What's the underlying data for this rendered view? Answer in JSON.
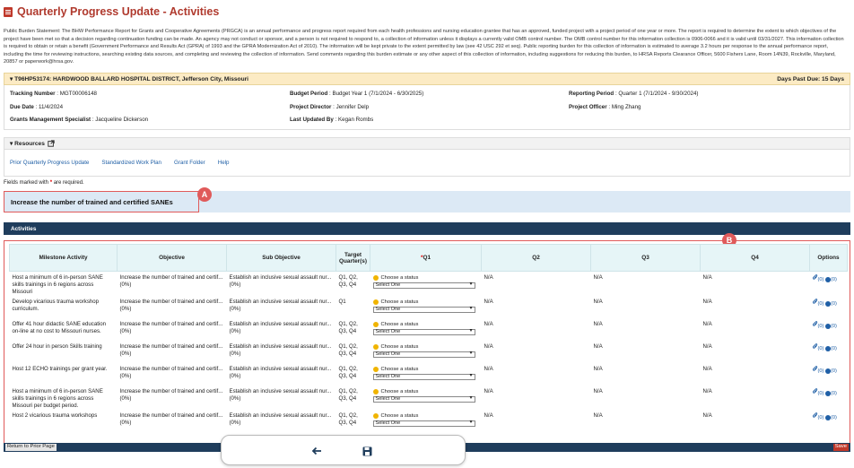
{
  "page": {
    "title": "Quarterly Progress Update - Activities",
    "burden_statement": "Public Burden Statement: The BHW Performance Report for Grants and Cooperative Agreements (PRGCA) is an annual performance and progress report required from each health professions and nursing education grantee that has an approved, funded project with a project period of one year or more. The report is required to determine the extent to which objectives of the project have been met so that a decision regarding continuation funding can be made. An agency may not conduct or sponsor, and a person is not required to respond to, a collection of information unless it displays a currently valid OMB control number. The OMB control number for this information collection is 0906-0066 and it is valid until 03/31/2027. This information collection is required to obtain or retain a benefit (Government Performance and Results Act (GPRA) of 1993 and the GPRA Modernization Act of 2010). The information will be kept private to the extent permitted by law (see 42 USC 292 et seq). Public reporting burden for this collection of information is estimated to average 3.2 hours per response to the annual performance report, including the time for reviewing instructions, searching existing data sources, and completing and reviewing the collection of information. Send comments regarding this burden estimate or any other aspect of this collection of information, including suggestions for reducing this burden, to HRSA Reports Clearance Officer, 5600 Fishers Lane, Room 14N39, Rockville, Maryland, 20857 or paperwork@hrsa.gov."
  },
  "grantee": {
    "header": "▾ T96HP53174: HARDWOOD BALLARD HOSPITAL DISTRICT, Jefferson City, Missouri",
    "days_past_due": "Days Past Due: 15 Days",
    "tracking_label": "Tracking Number",
    "tracking_value": ": MGT00006148",
    "due_label": "Due Date",
    "due_value": ": 11/4/2024",
    "gms_label": "Grants Management Specialist",
    "gms_value": ": Jacqueline Dickerson",
    "budget_label": "Budget Period",
    "budget_value": ": Budget Year 1 (7/1/2024 - 6/30/2025)",
    "director_label": "Project Director",
    "director_value": ": Jennifer Delp",
    "updated_label": "Last Updated By",
    "updated_value": ": Kegan Rombs",
    "reporting_label": "Reporting Period",
    "reporting_value": ": Quarter 1 (7/1/2024 - 9/30/2024)",
    "officer_label": "Project Officer",
    "officer_value": ": Ming Zhang"
  },
  "resources": {
    "header": "▾ Resources",
    "links": [
      "Prior Quarterly Progress Update",
      "Standardized Work Plan",
      "Grant Folder",
      "Help"
    ]
  },
  "required_note": {
    "prefix": "Fields marked with",
    "star": "*",
    "suffix": "are required."
  },
  "goal": "Increase the number of trained and certified SANEs",
  "activities_header": "Activities",
  "callouts": {
    "a": "A",
    "b": "B"
  },
  "table": {
    "headers": {
      "milestone": "Milestone Activity",
      "objective": "Objective",
      "sub_objective": "Sub Objective",
      "target": "Target Quarter(s)",
      "q1_star": "*",
      "q1": "Q1",
      "q2": "Q2",
      "q3": "Q3",
      "q4": "Q4",
      "options": "Options"
    },
    "status_prompt": "Choose a status",
    "select_default": "Select One",
    "na": "N/A",
    "attach_count": "(0)",
    "comment_count": "(0)",
    "rows": [
      {
        "milestone": "Host a minimum of 6 in-person SANE skills trainings in 6 regions across Missouri",
        "objective": "Increase the number of trained and certif...",
        "objective_pct": "(0%)",
        "sub_objective": "Establish an inclusive sexual assault nur...",
        "sub_pct": "(0%)",
        "target": "Q1, Q2, Q3, Q4"
      },
      {
        "milestone": "Develop vicarious trauma workshop curriculum.",
        "objective": "Increase the number of trained and certif...",
        "objective_pct": "(0%)",
        "sub_objective": "Establish an inclusive sexual assault nur...",
        "sub_pct": "(0%)",
        "target": "Q1"
      },
      {
        "milestone": "Offer 41 hour didactic SANE education on-line at no cost to Missouri nurses.",
        "objective": "Increase the number of trained and certif...",
        "objective_pct": "(0%)",
        "sub_objective": "Establish an inclusive sexual assault nur...",
        "sub_pct": "(0%)",
        "target": "Q1, Q2, Q3, Q4"
      },
      {
        "milestone": "Offer 24 hour in person Skills training",
        "objective": "Increase the number of trained and certif...",
        "objective_pct": "(0%)",
        "sub_objective": "Establish an inclusive sexual assault nur...",
        "sub_pct": "(0%)",
        "target": "Q1, Q2, Q3, Q4"
      },
      {
        "milestone": "Host 12 ECHO trainings per grant year.",
        "objective": "Increase the number of trained and certif...",
        "objective_pct": "(0%)",
        "sub_objective": "Establish an inclusive sexual assault nur...",
        "sub_pct": "(0%)",
        "target": "Q1, Q2, Q3, Q4"
      },
      {
        "milestone": "Host a minimum of 6 in-person SANE skills trainings in 6 regions across Missouri per budget period.",
        "objective": "Increase the number of trained and certif...",
        "objective_pct": "(0%)",
        "sub_objective": "Establish an inclusive sexual assault nur...",
        "sub_pct": "(0%)",
        "target": "Q1, Q2, Q3, Q4"
      },
      {
        "milestone": "Host 2 vicarious trauma workshops",
        "objective": "Increase the number of trained and certif...",
        "objective_pct": "(0%)",
        "sub_objective": "Establish an inclusive sexual assault nur...",
        "sub_pct": "(0%)",
        "target": "Q1, Q2, Q3, Q4"
      }
    ]
  },
  "footer": {
    "return_label": "Return to Prior Page",
    "save_label": "Save"
  },
  "floatbar": {
    "back_icon": "arrow-left-icon",
    "save_icon": "floppy-disk-icon"
  },
  "colors": {
    "title": "#b03a2e",
    "header_bar": "#1f3d5c",
    "callout": "#e05a5a",
    "grantee_bg": "#fcebc4",
    "goal_bg": "#dce9f5"
  }
}
